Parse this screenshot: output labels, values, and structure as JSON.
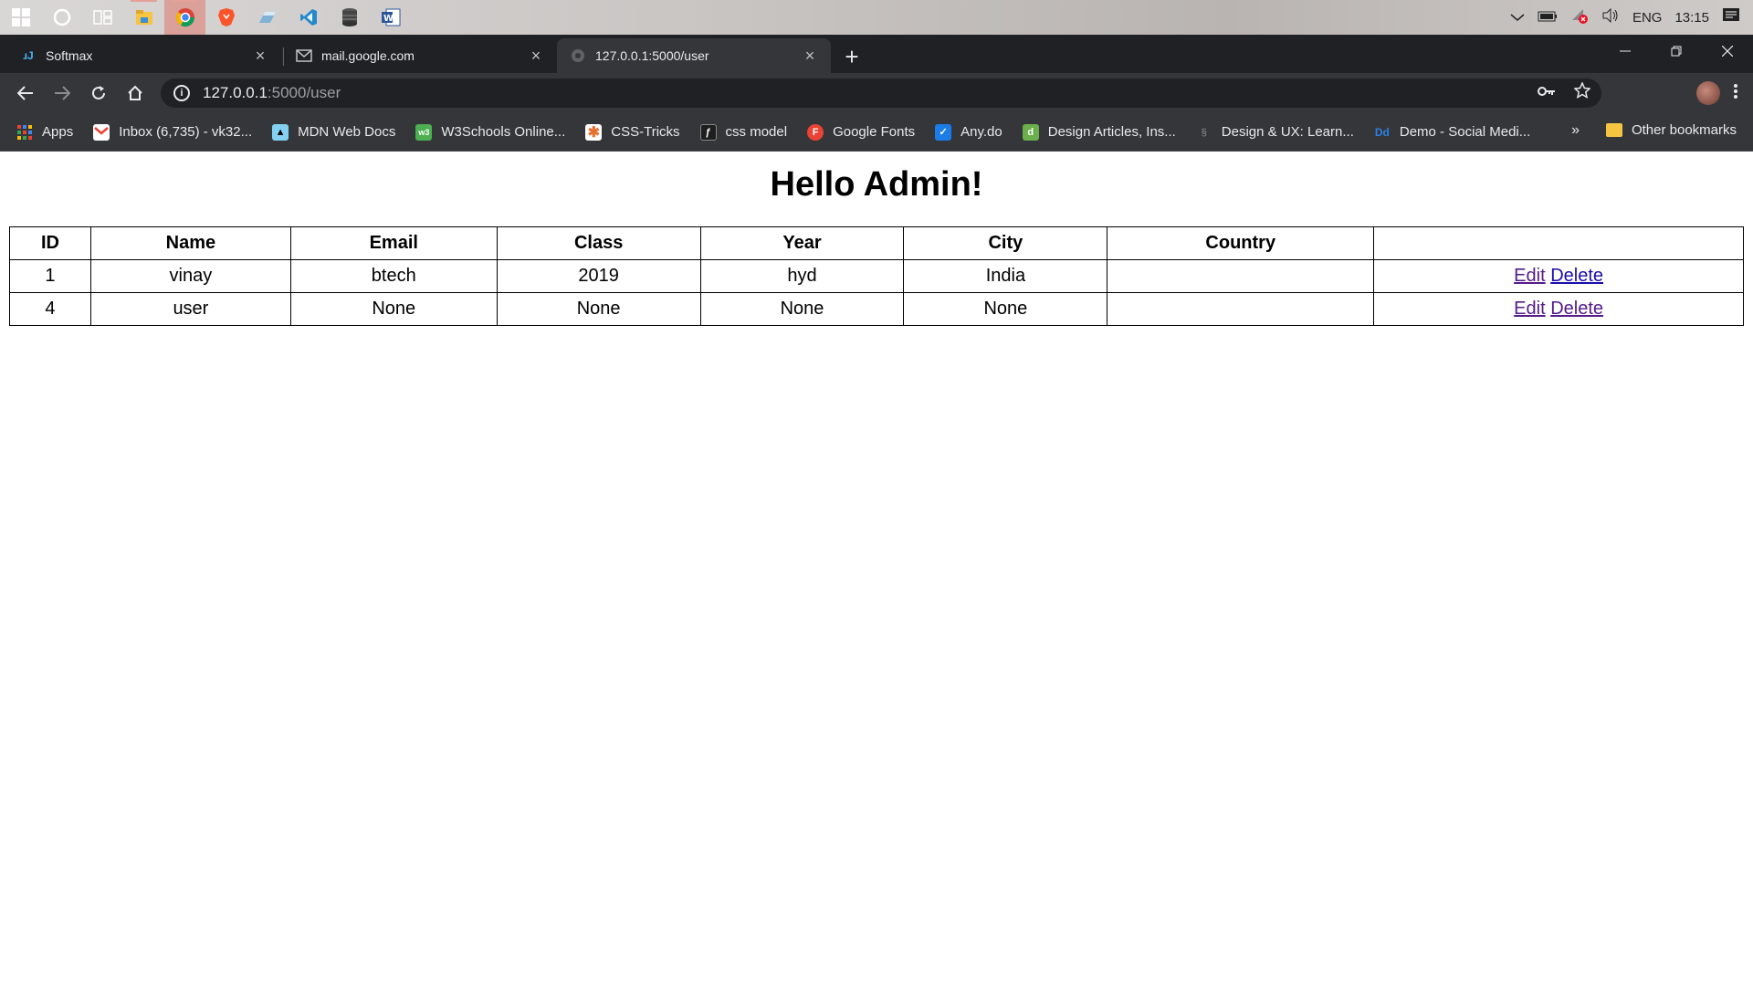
{
  "taskbar": {
    "apps": [
      {
        "icon": "windows-start-icon"
      },
      {
        "icon": "cortana-icon"
      },
      {
        "icon": "task-view-icon"
      },
      {
        "icon": "file-explorer-icon"
      },
      {
        "icon": "chrome-icon"
      },
      {
        "icon": "brave-icon"
      },
      {
        "icon": "app-icon"
      },
      {
        "icon": "vscode-icon"
      },
      {
        "icon": "database-icon"
      },
      {
        "icon": "word-icon"
      }
    ],
    "tray": {
      "language": "ENG",
      "time": "13:15"
    }
  },
  "browser": {
    "tabs": [
      {
        "title": "Softmax",
        "favicon": "softmax-icon",
        "active": false
      },
      {
        "title": "mail.google.com",
        "favicon": "mail-icon",
        "active": false
      },
      {
        "title": "127.0.0.1:5000/user",
        "favicon": "globe-icon",
        "active": true
      }
    ],
    "address": {
      "host": "127.0.0.1",
      "path": ":5000/user"
    },
    "bookmarks": [
      {
        "label": "Apps",
        "icon": "apps-grid-icon",
        "color": "#ea4335"
      },
      {
        "label": "Inbox (6,735) - vk32...",
        "icon": "gmail-icon",
        "color": "#ffffff"
      },
      {
        "label": "MDN Web Docs",
        "icon": "mdn-icon",
        "color": "#83d0f2"
      },
      {
        "label": "W3Schools Online...",
        "icon": "w3schools-icon",
        "color": "#4caf50"
      },
      {
        "label": "CSS-Tricks",
        "icon": "css-tricks-icon",
        "color": "#e6712e"
      },
      {
        "label": "css model",
        "icon": "figma-icon",
        "color": "#1e1e1e"
      },
      {
        "label": "Google Fonts",
        "icon": "google-fonts-icon",
        "color": "#ea4335"
      },
      {
        "label": "Any.do",
        "icon": "anydo-icon",
        "color": "#1c7ce8"
      },
      {
        "label": "Design Articles, Ins...",
        "icon": "design-icon",
        "color": "#6ab04c"
      },
      {
        "label": "Design & UX: Learn...",
        "icon": "sitepoint-icon",
        "color": "#444444"
      },
      {
        "label": "Demo - Social Medi...",
        "icon": "dd-icon",
        "color": "#2d7fe0"
      }
    ],
    "bookmarks_more": "»",
    "other_bookmarks": "Other bookmarks"
  },
  "page": {
    "heading": "Hello Admin!",
    "table": {
      "headers": [
        "ID",
        "Name",
        "Email",
        "Class",
        "Year",
        "City",
        "Country",
        ""
      ],
      "rows": [
        {
          "id": "1",
          "name": "vinay",
          "email": "btech",
          "class": "2019",
          "year": "hyd",
          "city": "India",
          "country": "",
          "edit": "Edit",
          "delete": "Delete"
        },
        {
          "id": "4",
          "name": "user",
          "email": "None",
          "class": "None",
          "year": "None",
          "city": "None",
          "country": "",
          "edit": "Edit",
          "delete": "Delete"
        }
      ]
    }
  }
}
